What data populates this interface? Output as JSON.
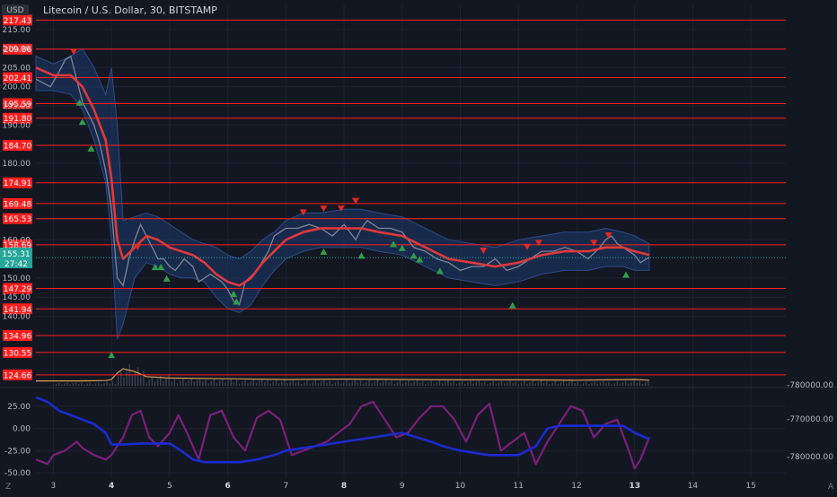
{
  "header": {
    "currency_badge": "USD",
    "symbol_title": "Litecoin / U.S. Dollar, 30, BITSTAMP",
    "bottom_left_label": "Z",
    "bottom_right_label": "A"
  },
  "colors": {
    "background": "#131722",
    "grid": "#1e2230",
    "axis_text": "#b2b5be",
    "level_line": "#ff1e1e",
    "level_label_bg": "#ff1e1e",
    "price_tag": "#26a69a",
    "price_path": "#7b8395",
    "moving_average": "#e0383a",
    "band_fill": "#1e3a6e",
    "volume_line": "#d4a05a",
    "volume_bars": "#3a3f4c",
    "sell_signal": "#e02828",
    "buy_signal": "#2e9e4a",
    "oscillator_a": "#7a1e7a",
    "oscillator_b": "#1a2ad0"
  },
  "chart_data": [
    {
      "type": "line",
      "title": "Litecoin / U.S. Dollar, 30, BITSTAMP",
      "xlabel": "",
      "ylabel": "",
      "x_ticks": [
        "3",
        "4",
        "5",
        "6",
        "7",
        "8",
        "9",
        "10",
        "11",
        "12",
        "13",
        "14",
        "15"
      ],
      "bold_x_ticks": [
        "4",
        "6",
        "8",
        "13"
      ],
      "xlim": [
        2.7,
        15.6
      ],
      "ylim": [
        123,
        218
      ],
      "y_ticks": [
        140,
        145,
        150,
        160,
        180,
        190,
        195,
        200,
        205,
        210,
        215
      ],
      "grid": true,
      "last_price_tag": {
        "price": "155.31",
        "countdown": "27:42"
      },
      "horizontal_levels": [
        217.43,
        209.86,
        202.41,
        195.59,
        191.8,
        184.7,
        174.91,
        169.48,
        165.53,
        158.69,
        147.29,
        141.94,
        134.96,
        130.55,
        124.66
      ],
      "level_labels": [
        "217.43",
        "209.86",
        "202.41",
        "195.59",
        "191.80",
        "184.70",
        "174.91",
        "169.48",
        "165.53",
        "158.69",
        "147.29",
        "141.94",
        "134.96",
        "130.55",
        "124.66"
      ],
      "series": [
        {
          "kind": "price",
          "x": [
            2.7,
            2.95,
            3.1,
            3.2,
            3.3,
            3.4,
            3.5,
            3.6,
            3.7,
            3.8,
            3.9,
            4.0,
            4.1,
            4.2,
            4.3,
            4.4,
            4.5,
            4.6,
            4.7,
            4.8,
            4.9,
            5.0,
            5.1,
            5.25,
            5.4,
            5.5,
            5.7,
            5.9,
            6.0,
            6.1,
            6.2,
            6.3,
            6.5,
            6.7,
            6.8,
            6.9,
            7.0,
            7.2,
            7.4,
            7.6,
            7.8,
            8.0,
            8.1,
            8.2,
            8.3,
            8.4,
            8.5,
            8.6,
            8.8,
            9.0,
            9.2,
            9.4,
            9.6,
            9.8,
            10.0,
            10.2,
            10.4,
            10.6,
            10.8,
            11.0,
            11.2,
            11.4,
            11.6,
            11.8,
            12.0,
            12.2,
            12.4,
            12.5,
            12.6,
            12.7,
            12.8,
            12.9,
            13.0,
            13.1,
            13.2,
            13.25
          ],
          "values": [
            202,
            200,
            204,
            207,
            208,
            202,
            196,
            193,
            190,
            185,
            178,
            168,
            150,
            148,
            155,
            160,
            164,
            161,
            158,
            155,
            155,
            153,
            152,
            155,
            153,
            149,
            151,
            149,
            147,
            144,
            143,
            149,
            152,
            157,
            161,
            162,
            163,
            163,
            164,
            163,
            161,
            164,
            162,
            160,
            163,
            165,
            164,
            163,
            163,
            162,
            158,
            157,
            155,
            154,
            152,
            153,
            153,
            155,
            152,
            153,
            155,
            157,
            157,
            158,
            157,
            155,
            158,
            160,
            161,
            159,
            158,
            157,
            156,
            154,
            155,
            155.31
          ]
        },
        {
          "kind": "moving_average",
          "x": [
            2.7,
            3.0,
            3.3,
            3.5,
            3.7,
            3.9,
            4.0,
            4.1,
            4.2,
            4.4,
            4.6,
            4.8,
            5.0,
            5.2,
            5.4,
            5.6,
            5.8,
            6.0,
            6.2,
            6.4,
            6.6,
            6.8,
            7.0,
            7.3,
            7.6,
            8.0,
            8.3,
            8.6,
            9.0,
            9.4,
            9.8,
            10.2,
            10.6,
            11.0,
            11.4,
            11.8,
            12.2,
            12.5,
            12.8,
            13.0,
            13.25
          ],
          "values": [
            205,
            203,
            203,
            200,
            194,
            186,
            176,
            160,
            155,
            158,
            161,
            160,
            158,
            157,
            156,
            154,
            151,
            149,
            148,
            150,
            154,
            157,
            160,
            162,
            163,
            163,
            163,
            162,
            161,
            158,
            155,
            154,
            153,
            154,
            156,
            157,
            157,
            158,
            158,
            157,
            156
          ]
        },
        {
          "kind": "band_upper",
          "x": [
            2.7,
            3.0,
            3.3,
            3.5,
            3.7,
            3.9,
            4.0,
            4.1,
            4.2,
            4.4,
            4.6,
            4.8,
            5.0,
            5.2,
            5.4,
            5.6,
            5.8,
            6.0,
            6.2,
            6.4,
            6.6,
            6.8,
            7.0,
            7.3,
            7.6,
            8.0,
            8.3,
            8.6,
            9.0,
            9.4,
            9.8,
            10.2,
            10.6,
            11.0,
            11.4,
            11.8,
            12.2,
            12.5,
            12.8,
            13.0,
            13.25
          ],
          "values": [
            208,
            206,
            208,
            210,
            205,
            198,
            205,
            190,
            165,
            166,
            167,
            166,
            164,
            162,
            160,
            159,
            158,
            156,
            155,
            157,
            160,
            162,
            165,
            167,
            167,
            168,
            168,
            167,
            166,
            163,
            160,
            159,
            158,
            160,
            161,
            162,
            162,
            163,
            162,
            161,
            159
          ]
        },
        {
          "kind": "band_lower",
          "x": [
            2.7,
            3.0,
            3.3,
            3.5,
            3.7,
            3.9,
            4.0,
            4.1,
            4.2,
            4.4,
            4.6,
            4.8,
            5.0,
            5.2,
            5.4,
            5.6,
            5.8,
            6.0,
            6.2,
            6.4,
            6.6,
            6.8,
            7.0,
            7.3,
            7.6,
            8.0,
            8.3,
            8.6,
            9.0,
            9.4,
            9.8,
            10.2,
            10.6,
            11.0,
            11.4,
            11.8,
            12.2,
            12.5,
            12.8,
            13.0,
            13.25
          ],
          "values": [
            199,
            199,
            198,
            194,
            186,
            175,
            160,
            134,
            138,
            150,
            154,
            153,
            151,
            150,
            150,
            149,
            145,
            142,
            141,
            143,
            148,
            152,
            155,
            157,
            158,
            158,
            158,
            157,
            156,
            153,
            150,
            149,
            148,
            149,
            151,
            152,
            152,
            153,
            153,
            152,
            152
          ]
        }
      ],
      "sell_signals": [
        [
          3.35,
          209
        ],
        [
          4.45,
          158
        ],
        [
          7.3,
          167
        ],
        [
          7.65,
          168
        ],
        [
          7.95,
          168
        ],
        [
          8.2,
          170
        ],
        [
          10.4,
          157
        ],
        [
          11.15,
          158
        ],
        [
          11.35,
          159
        ],
        [
          12.3,
          159
        ],
        [
          12.55,
          161
        ]
      ],
      "buy_signals": [
        [
          3.45,
          196
        ],
        [
          3.5,
          191
        ],
        [
          3.65,
          184
        ],
        [
          4.0,
          130
        ],
        [
          4.75,
          153
        ],
        [
          4.85,
          153
        ],
        [
          4.95,
          150
        ],
        [
          6.1,
          146
        ],
        [
          6.15,
          144
        ],
        [
          7.65,
          157
        ],
        [
          8.3,
          156
        ],
        [
          8.85,
          159
        ],
        [
          9.0,
          158
        ],
        [
          9.2,
          156
        ],
        [
          9.3,
          155
        ],
        [
          9.65,
          152
        ],
        [
          10.9,
          143
        ],
        [
          12.85,
          151
        ]
      ],
      "volume": {
        "x": [
          2.7,
          3.5,
          3.9,
          4.0,
          4.1,
          4.2,
          4.4,
          4.6,
          5.0,
          6.0,
          7.0,
          8.0,
          9.0,
          10.0,
          11.0,
          12.0,
          12.5,
          13.0,
          13.25
        ],
        "values": [
          0.3,
          0.3,
          0.35,
          0.5,
          1.4,
          2.0,
          1.6,
          0.9,
          0.7,
          0.6,
          0.5,
          0.55,
          0.5,
          0.45,
          0.45,
          0.4,
          0.45,
          0.5,
          0.4
        ]
      }
    },
    {
      "type": "line",
      "title": "",
      "xlabel": "",
      "ylabel": "",
      "left_axis": {
        "ylim": [
          -55,
          40
        ],
        "ticks": [
          25.0,
          0.0,
          -25.0,
          -50.0
        ],
        "tick_labels": [
          "25.00",
          "0.00",
          "-25.00",
          "-50.00"
        ]
      },
      "right_axis": {
        "tick_labels": [
          "-780000.00",
          "-770000.00",
          "-780000.00"
        ]
      },
      "series": [
        {
          "kind": "oscillator_a",
          "x": [
            2.7,
            2.9,
            3.0,
            3.2,
            3.4,
            3.5,
            3.7,
            3.9,
            4.0,
            4.2,
            4.35,
            4.5,
            4.65,
            4.8,
            5.0,
            5.15,
            5.3,
            5.5,
            5.7,
            5.9,
            6.1,
            6.3,
            6.5,
            6.7,
            6.9,
            7.1,
            7.3,
            7.5,
            7.7,
            7.9,
            8.1,
            8.3,
            8.5,
            8.7,
            8.9,
            9.1,
            9.3,
            9.5,
            9.7,
            9.9,
            10.1,
            10.3,
            10.5,
            10.7,
            10.9,
            11.1,
            11.3,
            11.5,
            11.7,
            11.9,
            12.1,
            12.3,
            12.5,
            12.7,
            12.9,
            13.0,
            13.1,
            13.25
          ],
          "values": [
            -35,
            -40,
            -30,
            -25,
            -15,
            -22,
            -30,
            -35,
            -30,
            -10,
            15,
            20,
            -10,
            -20,
            -5,
            15,
            -5,
            -35,
            15,
            20,
            -10,
            -25,
            12,
            20,
            10,
            -30,
            -25,
            -20,
            -15,
            -5,
            5,
            25,
            30,
            10,
            -10,
            -5,
            12,
            25,
            25,
            10,
            -15,
            15,
            28,
            -25,
            -15,
            -5,
            -40,
            -15,
            5,
            25,
            20,
            -10,
            5,
            10,
            -25,
            -45,
            -35,
            -10
          ]
        },
        {
          "kind": "oscillator_b",
          "x": [
            2.7,
            2.9,
            3.1,
            3.3,
            3.5,
            3.7,
            3.9,
            4.0,
            4.2,
            4.5,
            4.8,
            5.0,
            5.2,
            5.4,
            5.6,
            5.8,
            6.0,
            6.2,
            6.5,
            6.8,
            7.0,
            7.5,
            8.0,
            8.5,
            9.0,
            9.5,
            9.7,
            10.0,
            10.5,
            11.0,
            11.3,
            11.5,
            11.7,
            12.0,
            12.5,
            12.8,
            13.0,
            13.25
          ],
          "values": [
            35,
            30,
            20,
            15,
            10,
            5,
            -5,
            -18,
            -18,
            -17,
            -17,
            -17,
            -25,
            -35,
            -38,
            -38,
            -38,
            -38,
            -35,
            -30,
            -25,
            -20,
            -15,
            -10,
            -5,
            -15,
            -20,
            -25,
            -30,
            -30,
            -20,
            0,
            3,
            3,
            3,
            3,
            -5,
            -12
          ]
        }
      ]
    }
  ]
}
